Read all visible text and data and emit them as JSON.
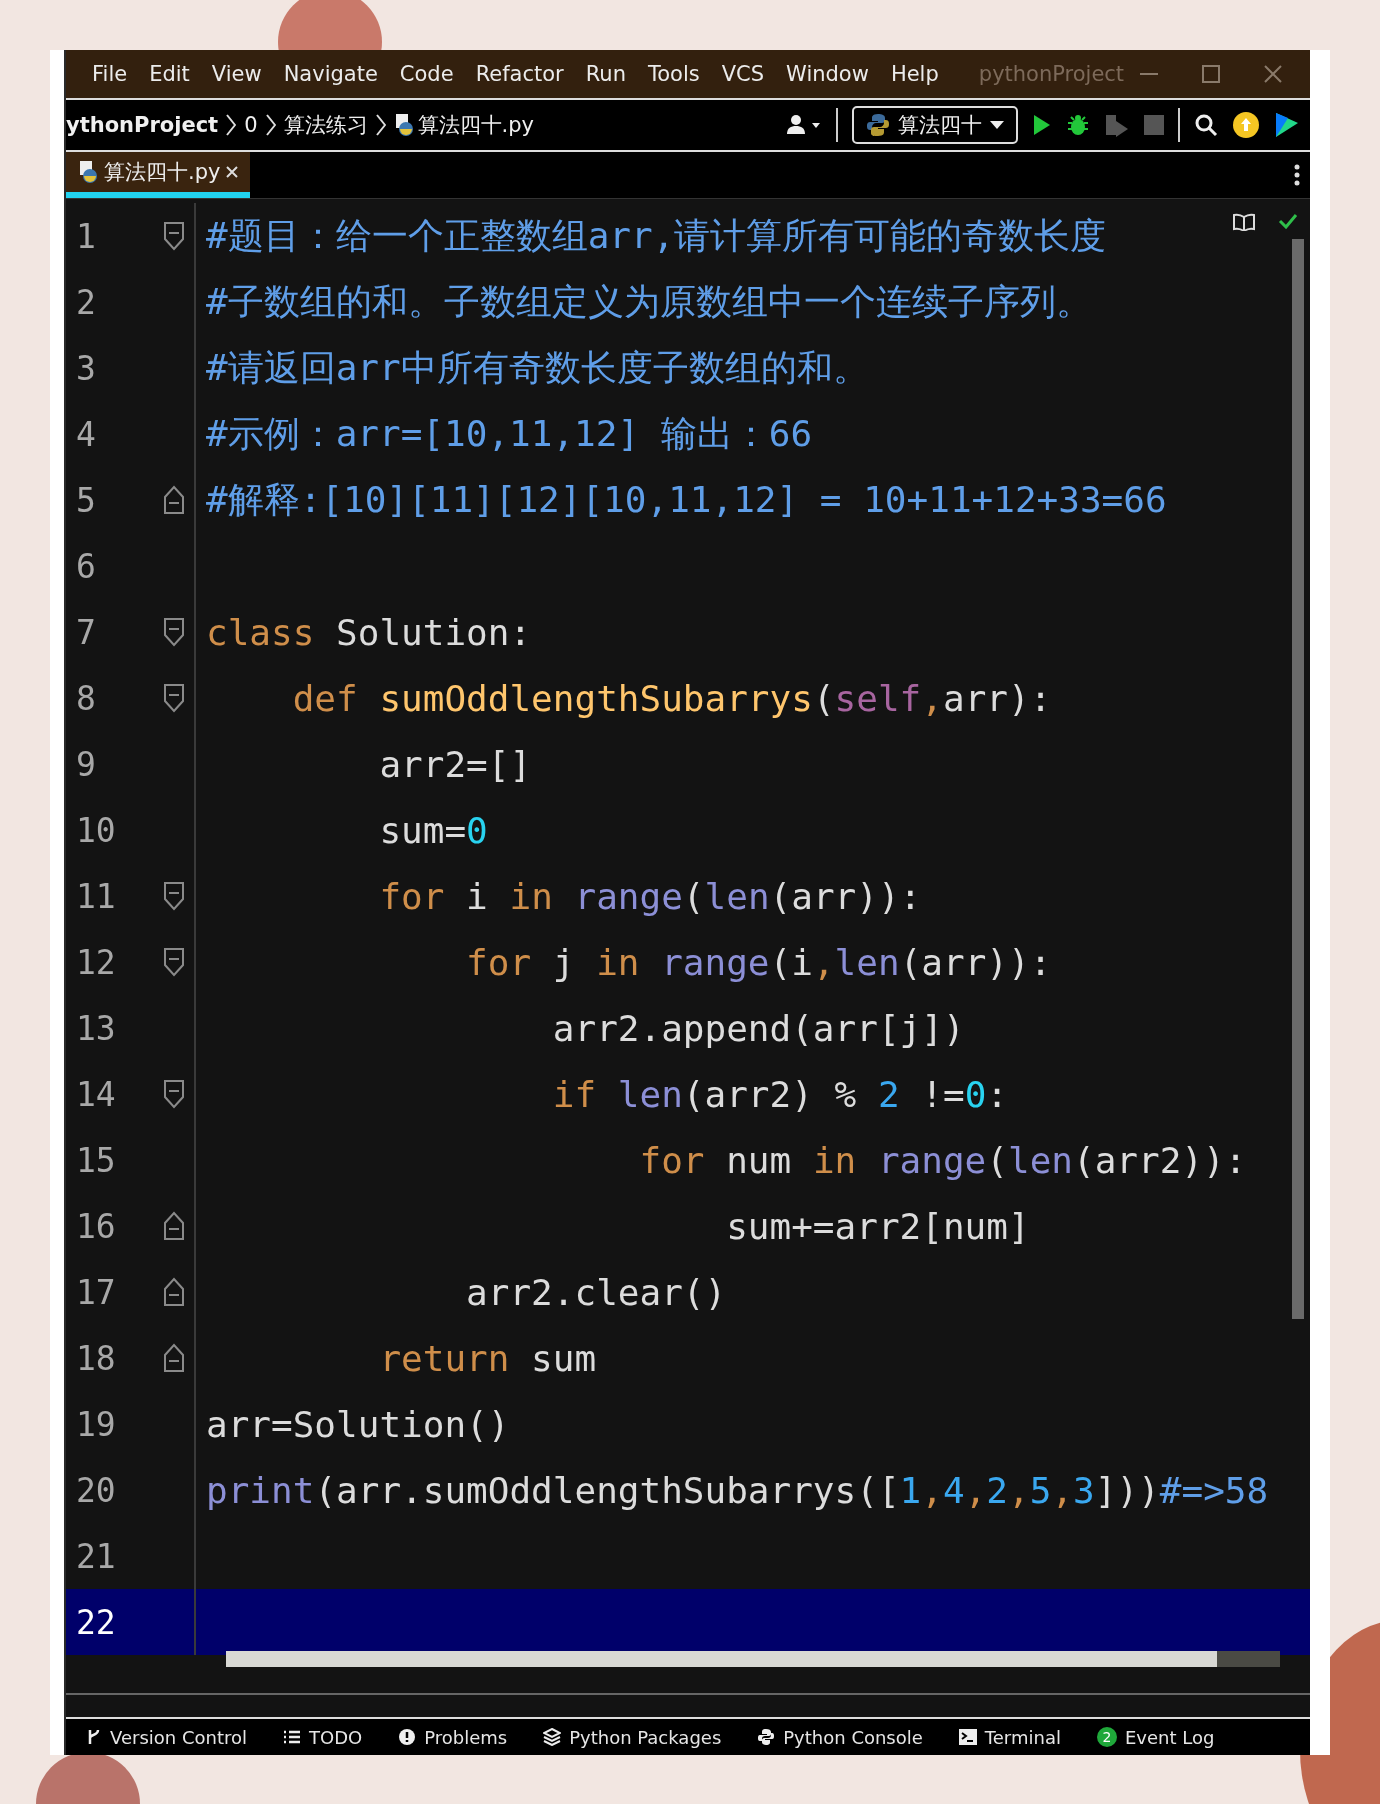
{
  "title_bar": {
    "menu": [
      "File",
      "Edit",
      "View",
      "Navigate",
      "Code",
      "Refactor",
      "Run",
      "Tools",
      "VCS",
      "Window",
      "Help"
    ],
    "title": "pythonProject"
  },
  "nav_bar": {
    "breadcrumbs": [
      "ythonProject",
      "0",
      "算法练习",
      "算法四十.py"
    ],
    "run_config": "算法四十"
  },
  "tabs": [
    {
      "label": "算法四十.py",
      "selected": true
    }
  ],
  "editor": {
    "lines": [
      {
        "number": "1",
        "fold_start": true,
        "fold_end": false,
        "selected": false,
        "tokens": [
          {
            "kind": "comment",
            "text": "#题目：给一个正整数组arr,请计算所有可能的奇数长度"
          }
        ]
      },
      {
        "number": "2",
        "fold_start": false,
        "fold_end": false,
        "selected": false,
        "tokens": [
          {
            "kind": "comment",
            "text": "#子数组的和。子数组定义为原数组中一个连续子序列。"
          }
        ]
      },
      {
        "number": "3",
        "fold_start": false,
        "fold_end": false,
        "selected": false,
        "tokens": [
          {
            "kind": "comment",
            "text": "#请返回arr中所有奇数长度子数组的和。"
          }
        ]
      },
      {
        "number": "4",
        "fold_start": false,
        "fold_end": false,
        "selected": false,
        "tokens": [
          {
            "kind": "comment",
            "text": "#示例：arr=[10,11,12] 输出：66"
          }
        ]
      },
      {
        "number": "5",
        "fold_start": false,
        "fold_end": true,
        "selected": false,
        "tokens": [
          {
            "kind": "comment",
            "text": "#解释:[10][11][12][10,11,12] = 10+11+12+33=66"
          }
        ]
      },
      {
        "number": "6",
        "fold_start": false,
        "fold_end": false,
        "selected": false
      },
      {
        "number": "7",
        "fold_start": true,
        "fold_end": false,
        "selected": false,
        "tokens": [
          {
            "kind": "keyword",
            "text": "class"
          },
          {
            "kind": "plain",
            "text": " Solution:"
          }
        ]
      },
      {
        "number": "8",
        "fold_start": true,
        "fold_end": false,
        "selected": false,
        "tokens": [
          {
            "kind": "keyword",
            "text": "    def "
          },
          {
            "kind": "function",
            "text": "sumOddlengthSubarrys"
          },
          {
            "kind": "plain",
            "text": "("
          },
          {
            "kind": "self",
            "text": "self"
          },
          {
            "kind": "keyword",
            "text": ","
          },
          {
            "kind": "plain",
            "text": "arr):"
          }
        ]
      },
      {
        "number": "9",
        "fold_start": false,
        "fold_end": false,
        "selected": false,
        "tokens": [
          {
            "kind": "plain",
            "text": "        arr2=[]"
          }
        ]
      },
      {
        "number": "10",
        "fold_start": false,
        "fold_end": false,
        "selected": false,
        "tokens": [
          {
            "kind": "plain",
            "text": "        sum="
          },
          {
            "kind": "number",
            "text": "0"
          }
        ]
      },
      {
        "number": "11",
        "fold_start": true,
        "fold_end": false,
        "selected": false,
        "tokens": [
          {
            "kind": "keyword",
            "text": "        for"
          },
          {
            "kind": "plain",
            "text": " i "
          },
          {
            "kind": "keyword",
            "text": "in "
          },
          {
            "kind": "builtin",
            "text": "range"
          },
          {
            "kind": "plain",
            "text": "("
          },
          {
            "kind": "builtin",
            "text": "len"
          },
          {
            "kind": "plain",
            "text": "(arr)):"
          }
        ]
      },
      {
        "number": "12",
        "fold_start": true,
        "fold_end": false,
        "selected": false,
        "tokens": [
          {
            "kind": "keyword",
            "text": "            for"
          },
          {
            "kind": "plain",
            "text": " j "
          },
          {
            "kind": "keyword",
            "text": "in "
          },
          {
            "kind": "builtin",
            "text": "range"
          },
          {
            "kind": "plain",
            "text": "(i"
          },
          {
            "kind": "keyword",
            "text": ","
          },
          {
            "kind": "builtin",
            "text": "len"
          },
          {
            "kind": "plain",
            "text": "(arr)):"
          }
        ]
      },
      {
        "number": "13",
        "fold_start": false,
        "fold_end": false,
        "selected": false,
        "tokens": [
          {
            "kind": "plain",
            "text": "                arr2.append(arr[j])"
          }
        ]
      },
      {
        "number": "14",
        "fold_start": true,
        "fold_end": false,
        "selected": false,
        "tokens": [
          {
            "kind": "keyword",
            "text": "                if "
          },
          {
            "kind": "builtin",
            "text": "len"
          },
          {
            "kind": "plain",
            "text": "(arr2) % "
          },
          {
            "kind": "digit",
            "text": "2"
          },
          {
            "kind": "plain",
            "text": " !="
          },
          {
            "kind": "number",
            "text": "0"
          },
          {
            "kind": "plain",
            "text": ":"
          }
        ]
      },
      {
        "number": "15",
        "fold_start": false,
        "fold_end": false,
        "selected": false,
        "tokens": [
          {
            "kind": "keyword",
            "text": "                    for"
          },
          {
            "kind": "plain",
            "text": " num "
          },
          {
            "kind": "keyword",
            "text": "in "
          },
          {
            "kind": "builtin",
            "text": "range"
          },
          {
            "kind": "plain",
            "text": "("
          },
          {
            "kind": "builtin",
            "text": "len"
          },
          {
            "kind": "plain",
            "text": "(arr2)):"
          }
        ]
      },
      {
        "number": "16",
        "fold_start": false,
        "fold_end": true,
        "selected": false,
        "tokens": [
          {
            "kind": "plain",
            "text": "                        sum+=arr2[num]"
          }
        ]
      },
      {
        "number": "17",
        "fold_start": false,
        "fold_end": true,
        "selected": false,
        "tokens": [
          {
            "kind": "plain",
            "text": "            arr2.clear()"
          }
        ]
      },
      {
        "number": "18",
        "fold_start": false,
        "fold_end": true,
        "selected": false,
        "tokens": [
          {
            "kind": "keyword",
            "text": "        return"
          },
          {
            "kind": "plain",
            "text": " sum"
          }
        ]
      },
      {
        "number": "19",
        "fold_start": false,
        "fold_end": false,
        "selected": false,
        "tokens": [
          {
            "kind": "plain",
            "text": "arr=Solution()"
          }
        ]
      },
      {
        "number": "20",
        "fold_start": false,
        "fold_end": false,
        "selected": false,
        "tokens": [
          {
            "kind": "builtin",
            "text": "print"
          },
          {
            "kind": "plain",
            "text": "(arr.sumOddlengthSubarrys(["
          },
          {
            "kind": "digit",
            "text": "1"
          },
          {
            "kind": "keyword",
            "text": ","
          },
          {
            "kind": "digit",
            "text": "4"
          },
          {
            "kind": "keyword",
            "text": ","
          },
          {
            "kind": "digit",
            "text": "2"
          },
          {
            "kind": "keyword",
            "text": ","
          },
          {
            "kind": "digit",
            "text": "5"
          },
          {
            "kind": "keyword",
            "text": ","
          },
          {
            "kind": "digit",
            "text": "3"
          },
          {
            "kind": "plain",
            "text": "]))"
          },
          {
            "kind": "comment",
            "text": "#=>58"
          }
        ]
      },
      {
        "number": "21",
        "fold_start": false,
        "fold_end": false,
        "selected": false
      },
      {
        "number": "22",
        "fold_start": false,
        "fold_end": false,
        "selected": true
      }
    ]
  },
  "tool_windows": [
    {
      "label": "Version Control",
      "kind": "vcs"
    },
    {
      "label": "TODO",
      "kind": "todo"
    },
    {
      "label": "Problems",
      "kind": "problems"
    },
    {
      "label": "Python Packages",
      "kind": "packages"
    },
    {
      "label": "Python Console",
      "kind": "console"
    },
    {
      "label": "Terminal",
      "kind": "terminal"
    },
    {
      "label": "Event Log",
      "kind": "event",
      "badge": "2"
    }
  ]
}
